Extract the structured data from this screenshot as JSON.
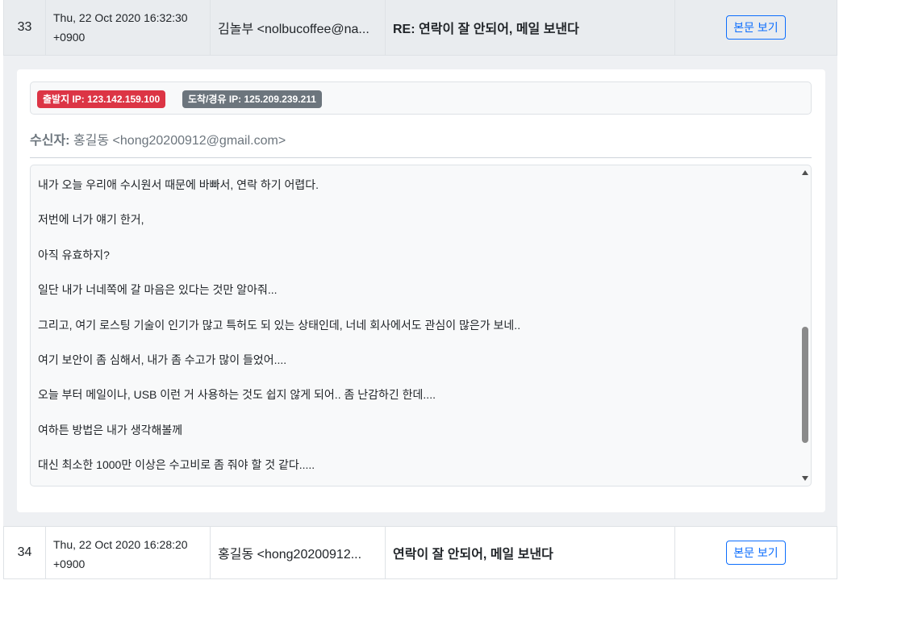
{
  "rows": [
    {
      "num": "33",
      "date_line1": "Thu, 22 Oct 2020 16:32:30",
      "date_line2": "+0900",
      "from": "김놀부 <nolbucoffee@na...",
      "subject": "RE: 연락이 잘 안되어, 메일 보낸다",
      "action": "본문 보기"
    },
    {
      "num": "34",
      "date_line1": "Thu, 22 Oct 2020 16:28:20",
      "date_line2": "+0900",
      "from": "홍길동 <hong20200912...",
      "subject": "연락이 잘 안되어, 메일 보낸다",
      "action": "본문 보기"
    }
  ],
  "detail": {
    "origin_ip": "출발지 IP: 123.142.159.100",
    "relay_ip": "도착/경유 IP: 125.209.239.211",
    "recipient_label": "수신자:",
    "recipient_value": "홍길동 <hong20200912@gmail.com>",
    "body_lines": [
      "내가 오늘 우리애 수시원서 때문에 바빠서, 연락 하기 어렵다.",
      "저번에 너가 얘기 한거,",
      "아직 유효하지?",
      "일단 내가 너네쪽에 갈 마음은 있다는 것만 알아줘...",
      "그리고, 여기 로스팅 기술이 인기가 많고 특허도 되 있는 상태인데, 너네 회사에서도 관심이 많은가 보네..",
      "여기 보안이 좀 심해서, 내가 좀 수고가 많이 들었어....",
      "오늘 부터 메일이나, USB 이런 거 사용하는 것도 쉽지 않게 되어.. 좀 난감하긴 한데....",
      "여하튼 방법은 내가 생각해볼께",
      "대신 최소한 1000만 이상은 수고비로 좀 줘야 할 것 같다....."
    ]
  },
  "colors": {
    "badge_red": "#dc3545",
    "badge_gray": "#6c757d",
    "button_blue": "#0d6efd"
  }
}
